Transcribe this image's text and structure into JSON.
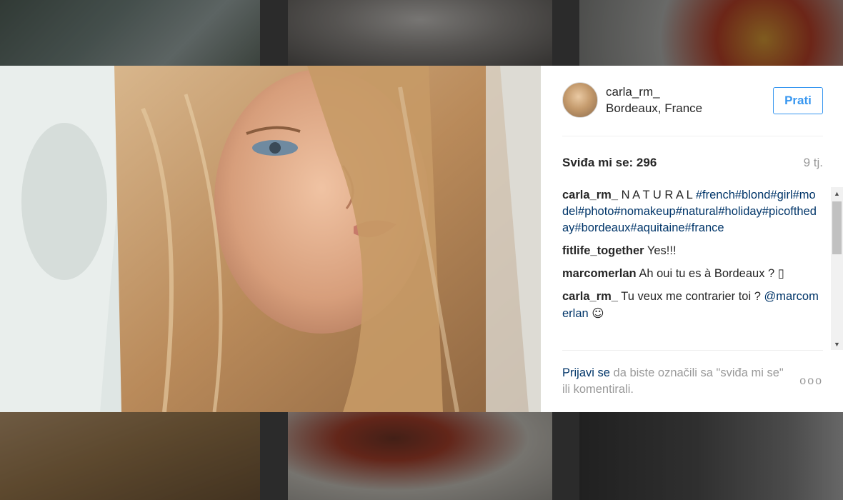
{
  "post": {
    "username": "carla_rm_",
    "location": "Bordeaux, France",
    "follow_label": "Prati",
    "likes_text": "Sviđa mi se: 296",
    "time_ago": "9 tj."
  },
  "comments": [
    {
      "user": "carla_rm_",
      "text": "N A T U R A L",
      "hashtags": "#french#blond#girl#model#photo#nomakeup#natural#holiday#picoftheday#bordeaux#aquitaine#france"
    },
    {
      "user": "fitlife_together",
      "text": "Yes!!!"
    },
    {
      "user": "marcomerlan",
      "text": "Ah oui tu es à Bordeaux ? ▯"
    },
    {
      "user": "carla_rm_",
      "text": "Tu veux me contrarier toi ?",
      "mention": "@marcomerlan",
      "emoji": "☺"
    }
  ],
  "footer": {
    "login_link": "Prijavi se",
    "login_rest": " da biste označili sa \"sviđa mi se\" ili komentirali.",
    "more_icon": "more-options-icon",
    "more_glyph": "ooo"
  }
}
